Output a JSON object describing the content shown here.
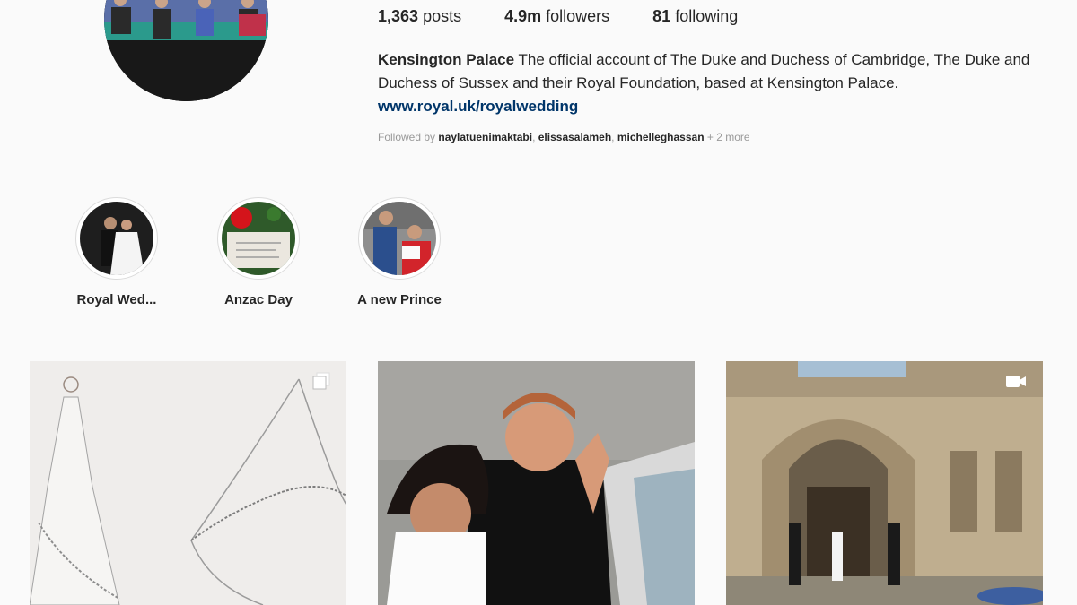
{
  "profile": {
    "posts_count": "1,363",
    "posts_label": "posts",
    "followers_count": "4.9m",
    "followers_label": "followers",
    "following_count": "81",
    "following_label": "following",
    "name": "Kensington Palace",
    "bio": "The official account of The Duke and Duchess of Cambridge, The Duke and Duchess of Sussex and their Royal Foundation, based at Kensington Palace.",
    "link": "www.royal.uk/royalwedding",
    "followed_by_prefix": "Followed by",
    "followed_by_users": [
      "naylatuenimaktabi",
      "elissasalameh",
      "michelleghassan"
    ],
    "followed_by_more": "+ 2 more"
  },
  "highlights": [
    {
      "label": "Royal Wed..."
    },
    {
      "label": "Anzac Day"
    },
    {
      "label": "A new Prince"
    }
  ],
  "posts": [
    {
      "icon": "carousel-icon"
    },
    {
      "icon": ""
    },
    {
      "icon": "video-icon"
    }
  ]
}
